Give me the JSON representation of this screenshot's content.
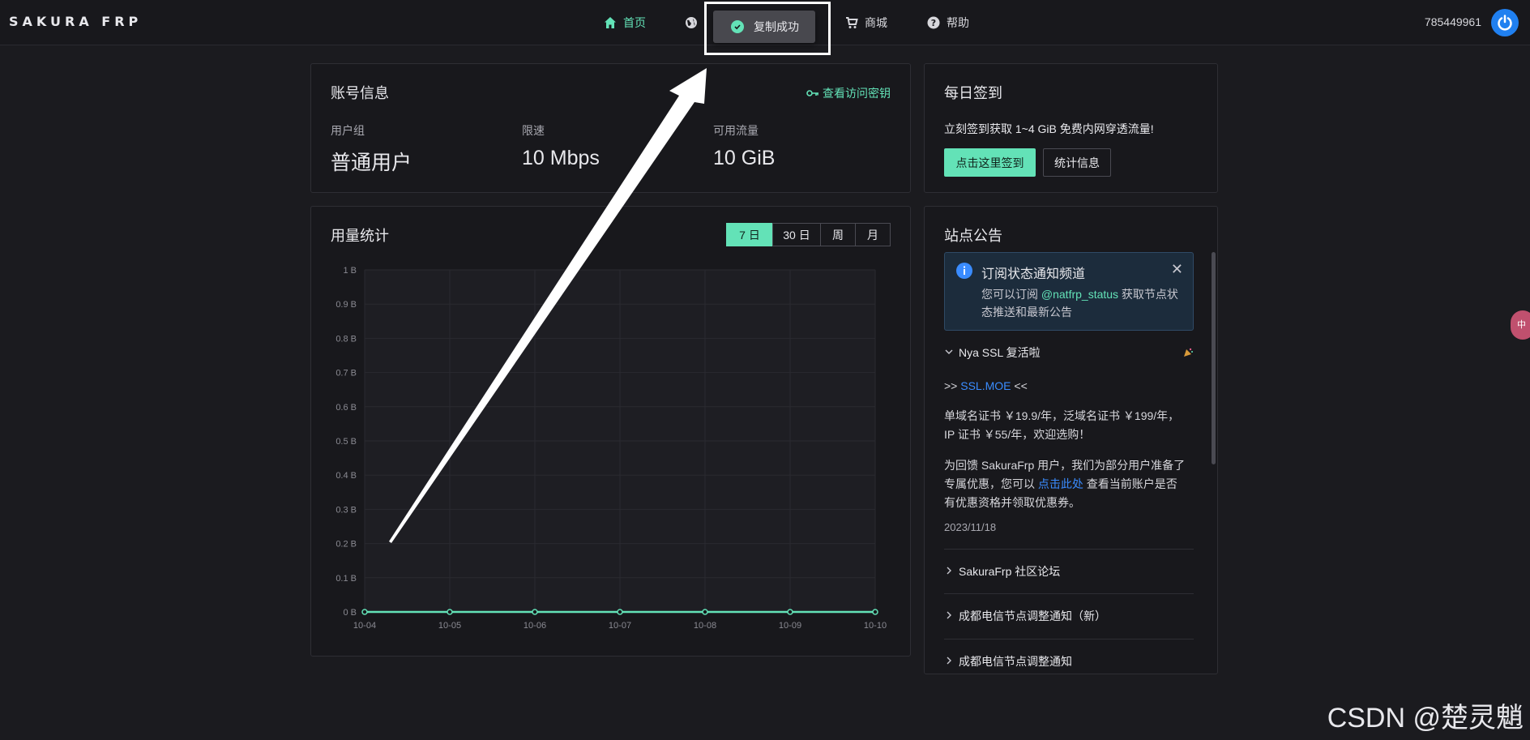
{
  "app": {
    "logo": "SAKURA FRP",
    "user_id": "785449961"
  },
  "nav": {
    "items": [
      {
        "label": "首页",
        "icon": "home-icon",
        "active": true
      },
      {
        "label": "",
        "icon": "globe-icon",
        "active": false
      },
      {
        "label": "商城",
        "icon": "cart-icon",
        "active": false
      },
      {
        "label": "帮助",
        "icon": "help-icon",
        "active": false
      }
    ]
  },
  "toast": {
    "message": "复制成功"
  },
  "account": {
    "title": "账号信息",
    "key_link": "查看访问密钥",
    "stats": [
      {
        "label": "用户组",
        "value": "普通用户"
      },
      {
        "label": "限速",
        "value": "10 Mbps"
      },
      {
        "label": "可用流量",
        "value": "10 GiB"
      }
    ]
  },
  "checkin": {
    "title": "每日签到",
    "text": "立刻签到获取 1~4 GiB 免费内网穿透流量!",
    "primary_button": "点击这里签到",
    "secondary_button": "统计信息"
  },
  "usage": {
    "title": "用量统计",
    "ranges": [
      "7 日",
      "30 日",
      "周",
      "月"
    ],
    "active_range": "7 日"
  },
  "chart_data": {
    "type": "line",
    "title": "",
    "xlabel": "",
    "ylabel": "",
    "x": [
      "10-04",
      "10-05",
      "10-06",
      "10-07",
      "10-08",
      "10-09",
      "10-10"
    ],
    "series": [
      {
        "values": [
          0,
          0,
          0,
          0,
          0,
          0,
          0
        ]
      }
    ],
    "yticks": [
      "0 B",
      "0.1 B",
      "0.2 B",
      "0.3 B",
      "0.4 B",
      "0.5 B",
      "0.6 B",
      "0.7 B",
      "0.8 B",
      "0.9 B",
      "1 B"
    ],
    "ylim": [
      0,
      1
    ],
    "grid": true,
    "line_color": "#63e2b7"
  },
  "announcements": {
    "title": "站点公告",
    "notice": {
      "title": "订阅状态通知频道",
      "body_prefix": "您可以订阅 ",
      "body_link": "@natfrp_status",
      "body_suffix": " 获取节点状态推送和最新公告"
    },
    "expanded": {
      "title": "Nya SSL 复活啦",
      "line1_prefix": ">> ",
      "line1_link": "SSL.MOE",
      "line1_suffix": " <<",
      "line2": "单域名证书 ￥19.9/年，泛域名证书 ￥199/年，IP 证书 ￥55/年，欢迎选购！",
      "line3_prefix": "为回馈 SakuraFrp 用户，我们为部分用户准备了专属优惠，您可以 ",
      "line3_link": "点击此处",
      "line3_suffix": " 查看当前账户是否有优惠资格并领取优惠券。",
      "date": "2023/11/18"
    },
    "collapsed": [
      "SakuraFrp 社区论坛",
      "成都电信节点调整通知（新）",
      "成都电信节点调整通知"
    ]
  },
  "side_tab": "中",
  "watermark": "CSDN @楚灵魈"
}
